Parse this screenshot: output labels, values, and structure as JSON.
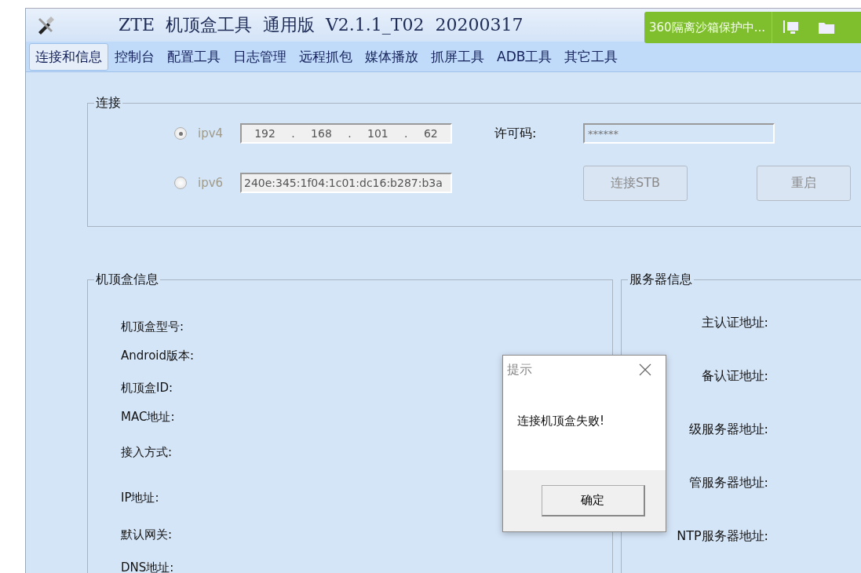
{
  "window": {
    "title": "ZTE  机顶盒工具  通用版  V2.1.1_T02  20200317"
  },
  "sandbox_badge": {
    "text": "360隔离沙箱保护中..."
  },
  "tabs": [
    {
      "label": "连接和信息",
      "selected": true
    },
    {
      "label": "控制台",
      "selected": false
    },
    {
      "label": "配置工具",
      "selected": false
    },
    {
      "label": "日志管理",
      "selected": false
    },
    {
      "label": "远程抓包",
      "selected": false
    },
    {
      "label": "媒体播放",
      "selected": false
    },
    {
      "label": "抓屏工具",
      "selected": false
    },
    {
      "label": "ADB工具",
      "selected": false
    },
    {
      "label": "其它工具",
      "selected": false
    }
  ],
  "connection": {
    "title": "连接",
    "ipv4": {
      "label": "ipv4",
      "selected": true,
      "octets": [
        "192",
        "168",
        "101",
        "62"
      ],
      "separator": "."
    },
    "ipv6": {
      "label": "ipv6",
      "selected": false,
      "value": "240e:345:1f04:1c01:dc16:b287:b3a"
    },
    "license": {
      "label": "许可码:",
      "value": "******"
    },
    "buttons": [
      {
        "label": "连接STB",
        "disabled": true
      },
      {
        "label": "重启",
        "disabled": true
      }
    ]
  },
  "stb_info": {
    "title": "机顶盒信息",
    "labels": [
      "机顶盒型号:",
      "Android版本:",
      "机顶盒ID:",
      "MAC地址:",
      "接入方式:",
      "IP地址:",
      "默认网关:",
      "DNS地址:"
    ]
  },
  "server_info": {
    "title": "服务器信息",
    "labels": [
      "主认证地址:",
      "备认证地址:",
      "级服务器地址:",
      "管服务器地址:",
      "NTP服务器地址:"
    ]
  },
  "dialog": {
    "title": "提示",
    "message": "连接机顶盒失败!",
    "button": "确定"
  }
}
